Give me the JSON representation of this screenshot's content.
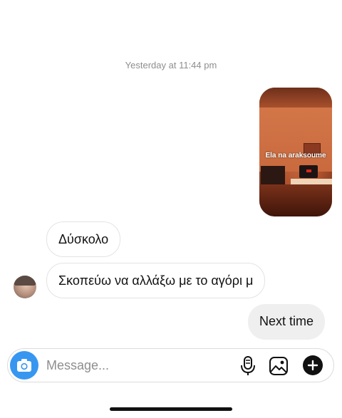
{
  "thread": {
    "timestamp": "Yesterday at 11:44 pm",
    "story_reply": {
      "caption": "Ela na araksoume"
    },
    "messages": [
      {
        "direction": "incoming",
        "text": "Δύσκολο"
      },
      {
        "direction": "incoming",
        "text": "Σκοπεύω να αλλάξω με το αγόρι μ"
      },
      {
        "direction": "outgoing",
        "text": "Next time"
      }
    ]
  },
  "composer": {
    "placeholder": "Message...",
    "value": "",
    "icons": {
      "camera": "camera-icon",
      "mic": "microphone-icon",
      "gallery": "gallery-icon",
      "plus": "plus-circle-icon"
    },
    "accent_color": "#3797f0"
  }
}
